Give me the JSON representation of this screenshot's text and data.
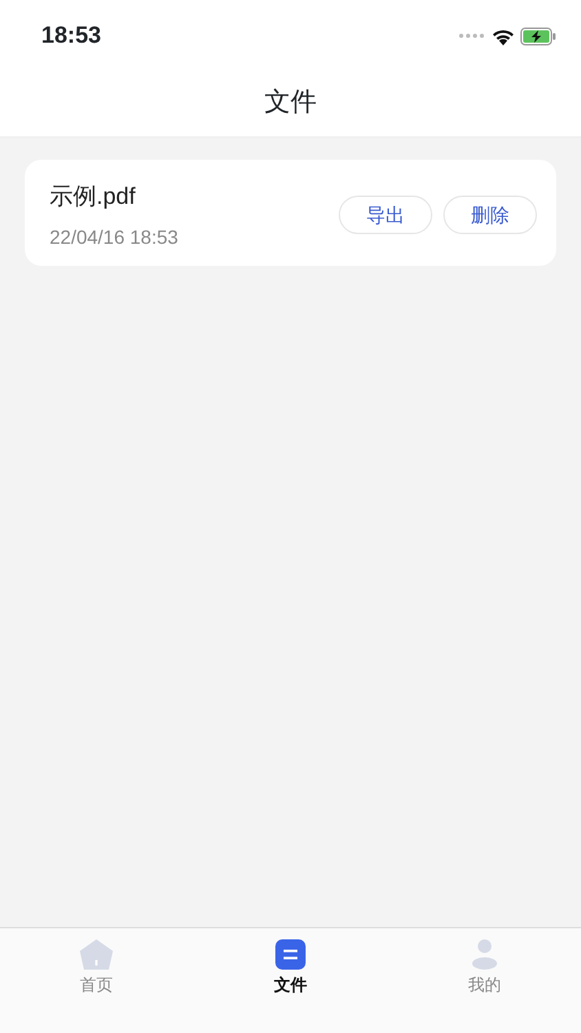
{
  "status_bar": {
    "time": "18:53"
  },
  "header": {
    "title": "文件"
  },
  "files": [
    {
      "name": "示例.pdf",
      "date": "22/04/16 18:53",
      "actions": [
        "导出",
        "删除"
      ]
    }
  ],
  "tabs": [
    {
      "label": "首页",
      "kind": "home",
      "selected": false
    },
    {
      "label": "文件",
      "kind": "files",
      "selected": true
    },
    {
      "label": "我的",
      "kind": "profile",
      "selected": false
    }
  ]
}
